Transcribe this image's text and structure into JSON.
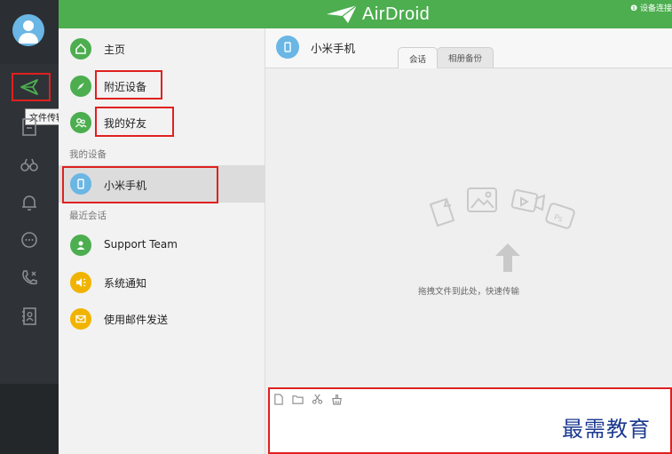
{
  "app": {
    "brand": "AirDroid",
    "status": "❶ 设备连接"
  },
  "rail": {
    "tooltip": "文件传输",
    "items": [
      {
        "icon": "paper-plane-icon",
        "active": true
      },
      {
        "icon": "file-icon"
      },
      {
        "icon": "binoculars-icon"
      },
      {
        "icon": "bell-icon"
      },
      {
        "icon": "chat-bubble-icon"
      },
      {
        "icon": "phone-call-icon"
      },
      {
        "icon": "contacts-icon"
      }
    ]
  },
  "contacts": {
    "home": "主页",
    "nearby": "附近设备",
    "friends": "我的好友",
    "my_devices_label": "我的设备",
    "device_name": "小米手机",
    "recent_label": "最近会话",
    "recent": [
      {
        "label": "Support Team",
        "icon": "support-icon",
        "color": "#4cae4f"
      },
      {
        "label": "系统通知",
        "icon": "speaker-icon",
        "color": "#f0b400"
      },
      {
        "label": "使用邮件发送",
        "icon": "mail-icon",
        "color": "#f0b400"
      }
    ]
  },
  "main": {
    "device_title": "小米手机",
    "tabs": [
      "会话",
      "相册备份"
    ],
    "drop_hint": "拖拽文件到此处，快速传输"
  },
  "watermark": "最需教育",
  "colors": {
    "brand_green": "#4cae4f",
    "highlight_red": "#e02020",
    "device_blue": "#6ab6e5",
    "notify_yellow": "#f0b400"
  }
}
